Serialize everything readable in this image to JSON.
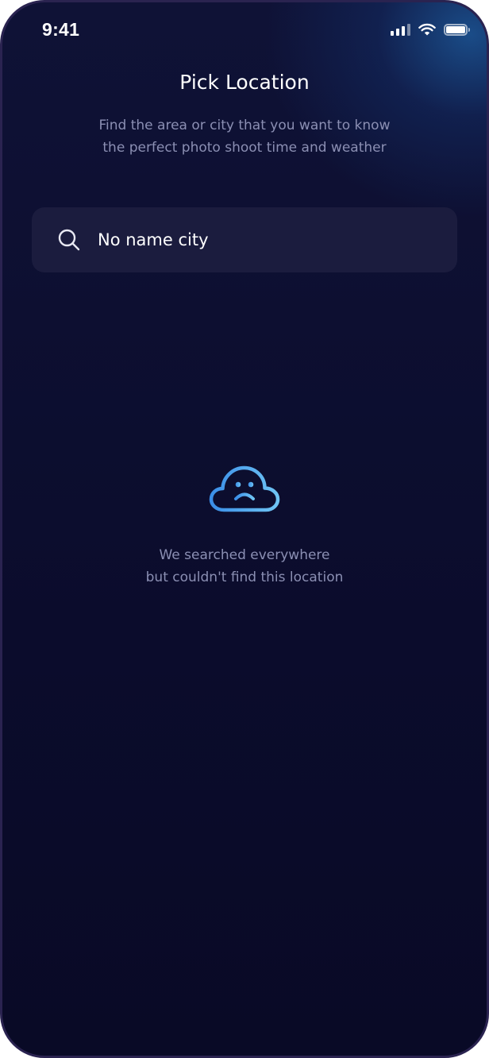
{
  "status_bar": {
    "time": "9:41",
    "icons": [
      "cellular-signal-icon",
      "wifi-icon",
      "battery-icon"
    ],
    "battery_level": 1.0
  },
  "header": {
    "title": "Pick Location",
    "subtitle_line1": "Find the area or city that you want to know",
    "subtitle_line2": "the perfect photo shoot time and weather"
  },
  "search": {
    "icon": "search-icon",
    "value": "No name city"
  },
  "empty_state": {
    "icon": "sad-cloud-icon",
    "line1": "We searched everywhere",
    "line2": "but couldn't find this location"
  },
  "colors": {
    "background": "#0b0c2c",
    "accent_glow": "#1c5696",
    "search_field": "#1b1c3e",
    "muted_text": "#8b8fb3",
    "icon_gradient_start": "#3a8ee8",
    "icon_gradient_end": "#6fc4f4"
  }
}
